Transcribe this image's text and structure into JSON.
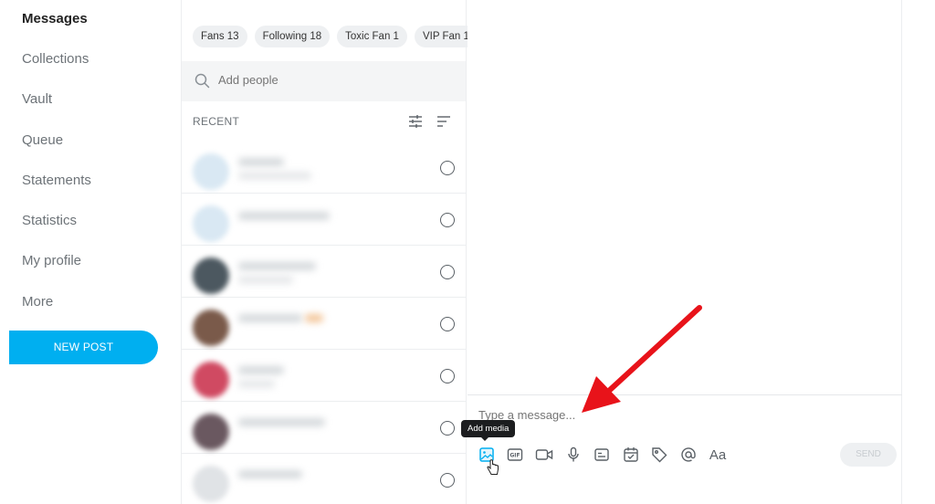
{
  "sidebar": {
    "items": [
      {
        "label": "Messages"
      },
      {
        "label": "Collections"
      },
      {
        "label": "Vault"
      },
      {
        "label": "Queue"
      },
      {
        "label": "Statements"
      },
      {
        "label": "Statistics"
      },
      {
        "label": "My profile"
      },
      {
        "label": "More"
      }
    ],
    "new_post": "NEW POST"
  },
  "chats": {
    "chips": [
      "Fans 13",
      "Following 18",
      "Toxic Fan 1",
      "VIP Fan 1"
    ],
    "search_placeholder": "Add people",
    "recent_label": "RECENT"
  },
  "composer": {
    "placeholder": "Type a message...",
    "tooltip": "Add media",
    "font_button": "Aa",
    "send_label": "SEND",
    "tools": [
      "image-icon",
      "gif-icon",
      "video-icon",
      "microphone-icon",
      "poll-icon",
      "schedule-icon",
      "price-tag-icon",
      "mention-icon",
      "text-format-icon"
    ]
  },
  "colors": {
    "accent": "#00aff0",
    "annotation_arrow": "#e8131a"
  }
}
